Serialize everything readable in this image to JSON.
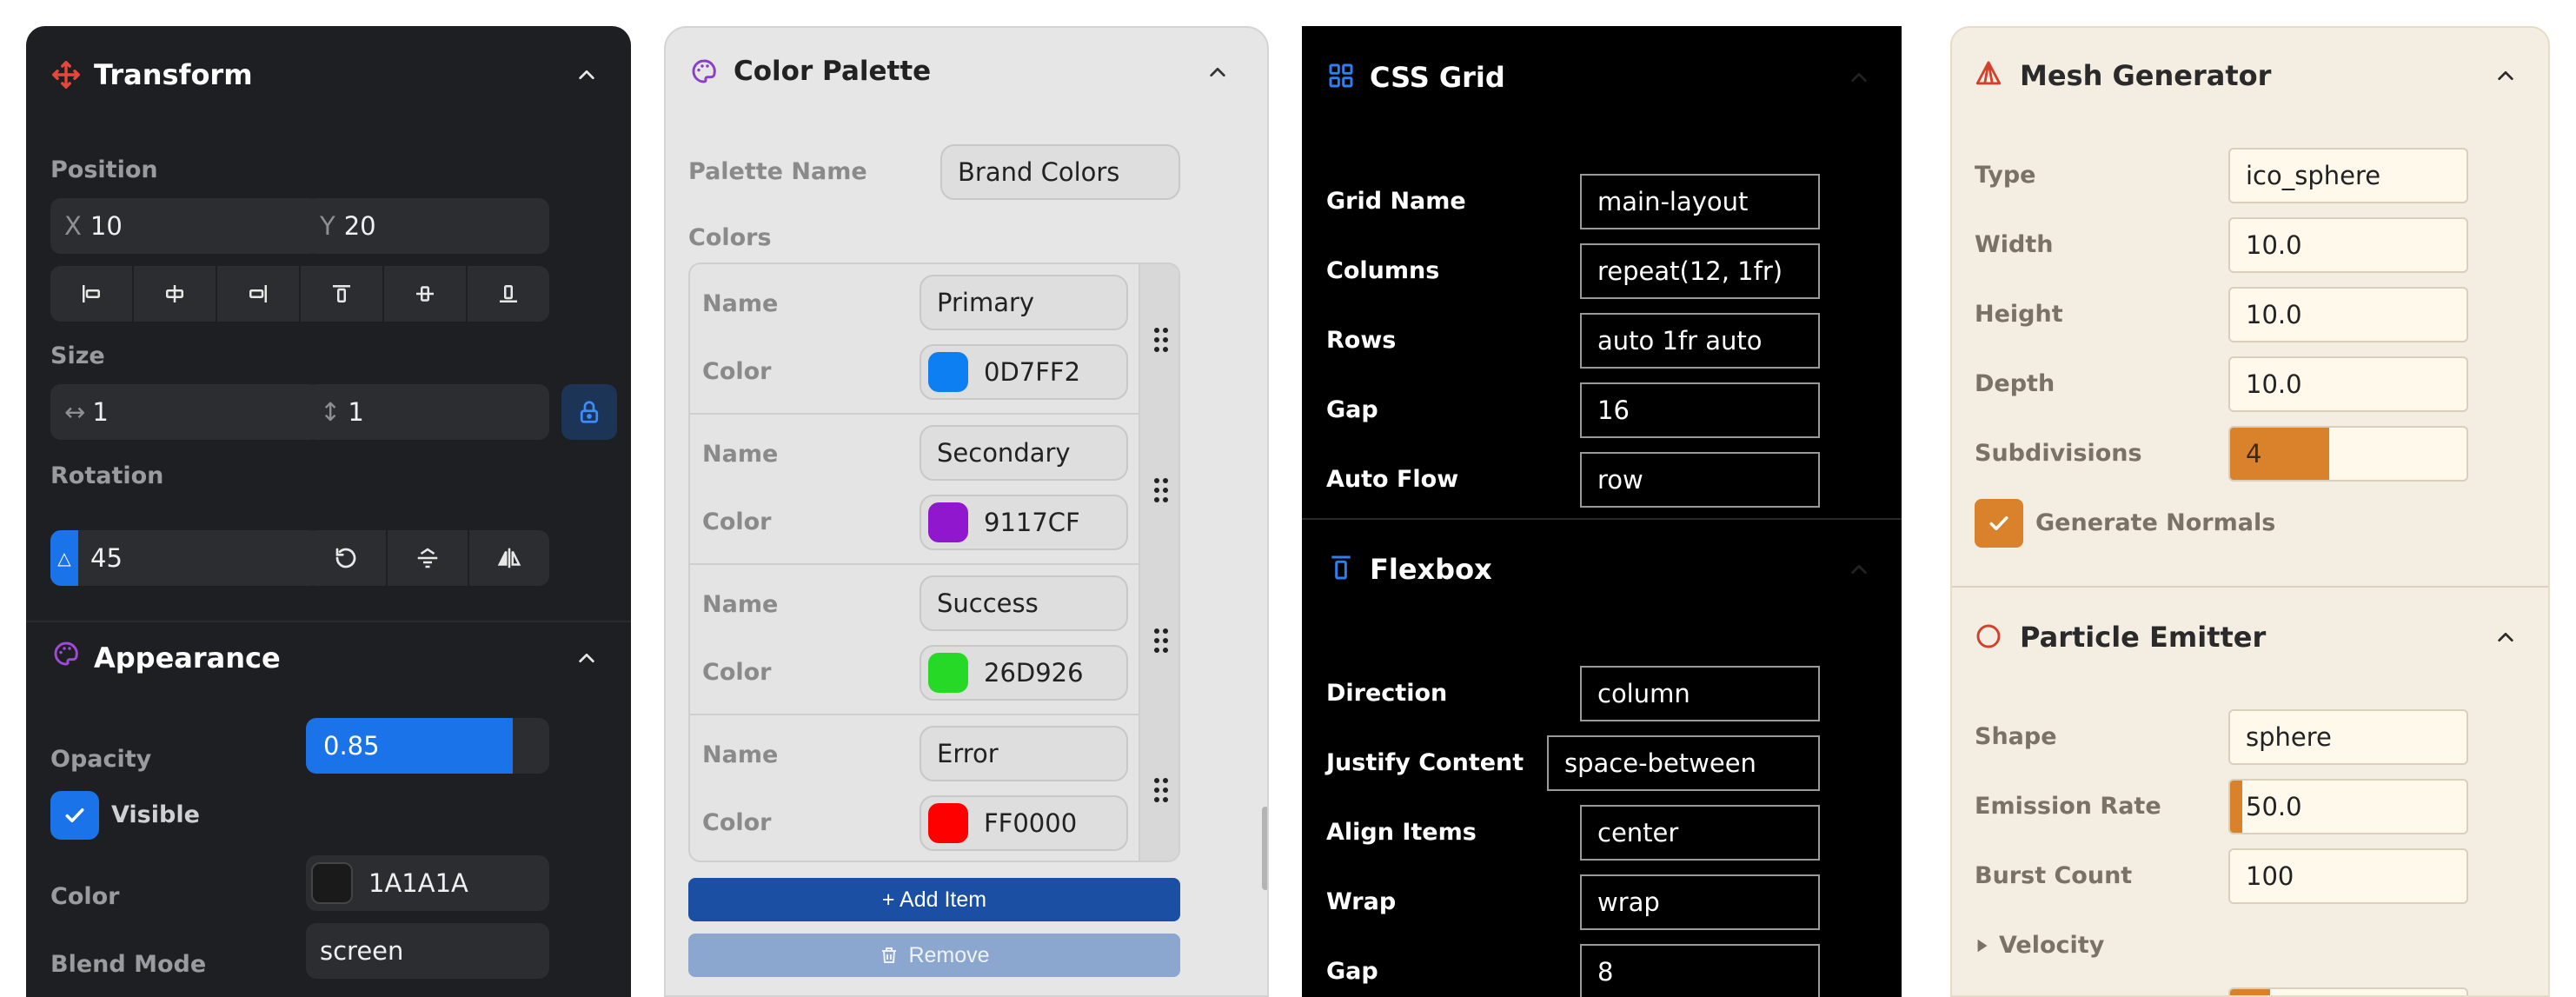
{
  "transform": {
    "title": "Transform",
    "position_label": "Position",
    "x_prefix": "X",
    "x_value": "10",
    "y_prefix": "Y",
    "y_value": "20",
    "size_label": "Size",
    "width_value": "1",
    "height_value": "1",
    "rotation_label": "Rotation",
    "rotation_value": "45",
    "accent": "#1a73e8"
  },
  "appearance": {
    "title": "Appearance",
    "opacity_label": "Opacity",
    "opacity_value": "0.85",
    "opacity_fraction": 0.85,
    "visible_label": "Visible",
    "color_label": "Color",
    "color_value": "1A1A1A",
    "blend_label": "Blend Mode",
    "blend_value": "screen"
  },
  "palette": {
    "title": "Color Palette",
    "name_label": "Palette Name",
    "name_value": "Brand Colors",
    "colors_label": "Colors",
    "items": [
      {
        "name_label": "Name",
        "name": "Primary",
        "color_label": "Color",
        "hex": "0D7FF2",
        "swatch": "#0D7FF2"
      },
      {
        "name_label": "Name",
        "name": "Secondary",
        "color_label": "Color",
        "hex": "9117CF",
        "swatch": "#9117CF"
      },
      {
        "name_label": "Name",
        "name": "Success",
        "color_label": "Color",
        "hex": "26D926",
        "swatch": "#26D926"
      },
      {
        "name_label": "Name",
        "name": "Error",
        "color_label": "Color",
        "hex": "FF0000",
        "swatch": "#FF0000"
      }
    ],
    "add_label": "+ Add Item",
    "remove_label": "Remove",
    "add_color": "#1a4fa3",
    "remove_color": "#8ba7cf"
  },
  "grid": {
    "title": "CSS Grid",
    "rows": [
      {
        "label": "Grid Name",
        "value": "main-layout"
      },
      {
        "label": "Columns",
        "value": "repeat(12, 1fr)"
      },
      {
        "label": "Rows",
        "value": "auto 1fr auto"
      },
      {
        "label": "Gap",
        "value": "16"
      },
      {
        "label": "Auto Flow",
        "value": "row"
      }
    ]
  },
  "flexbox": {
    "title": "Flexbox",
    "rows": [
      {
        "label": "Direction",
        "value": "column"
      },
      {
        "label": "Justify Content",
        "value": "space-between"
      },
      {
        "label": "Align Items",
        "value": "center"
      },
      {
        "label": "Wrap",
        "value": "wrap"
      },
      {
        "label": "Gap",
        "value": "8"
      }
    ]
  },
  "mesh": {
    "title": "Mesh Generator",
    "rows": [
      {
        "label": "Type",
        "value": "ico_sphere"
      },
      {
        "label": "Width",
        "value": "10.0"
      },
      {
        "label": "Height",
        "value": "10.0"
      },
      {
        "label": "Depth",
        "value": "10.0"
      },
      {
        "label": "Subdivisions",
        "value": "4"
      }
    ],
    "subdivisions_fraction": 0.42,
    "normals_label": "Generate Normals",
    "accent": "#d9822b"
  },
  "particle": {
    "title": "Particle Emitter",
    "shape_label": "Shape",
    "shape_value": "sphere",
    "rate_label": "Emission Rate",
    "rate_value": "50.0",
    "rate_fraction": 0.05,
    "burst_label": "Burst Count",
    "burst_value": "100",
    "velocity_label": "Velocity"
  }
}
